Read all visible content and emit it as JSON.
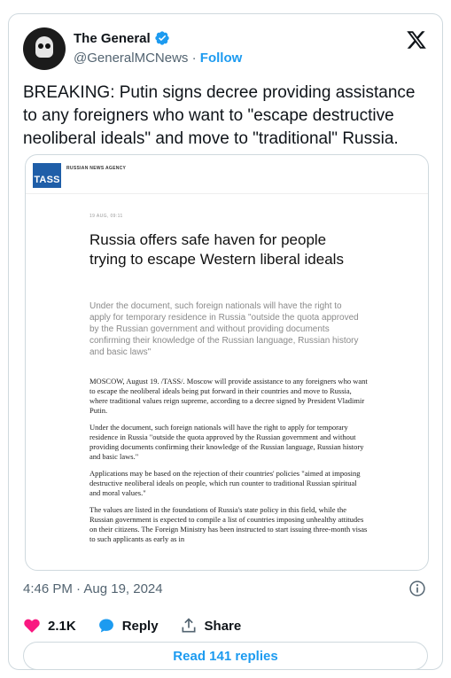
{
  "author": {
    "name": "The General",
    "handle": "@GeneralMCNews",
    "separator": "·",
    "follow_label": "Follow"
  },
  "tweet": {
    "text": "BREAKING: Putin signs decree providing assistance to any foreigners who want to \"escape destructive neoliberal ideals\" and move to \"traditional\" Russia."
  },
  "media": {
    "agency_logo": "TASS",
    "agency_name": "RUSSIAN NEWS AGENCY",
    "date": "19 AUG, 09:11",
    "title": "Russia offers safe haven for people trying to escape Western liberal ideals",
    "lead": "Under the document, such foreign nationals will have the right to apply for temporary residence in Russia \"outside the quota approved by the Russian government and without providing documents confirming their knowledge of the Russian language, Russian history and basic laws\"",
    "paragraphs": [
      "MOSCOW, August 19. /TASS/. Moscow will provide assistance to any foreigners who want to escape the neoliberal ideals being put forward in their countries and move to Russia, where traditional values reign supreme, according to a decree signed by President Vladimir Putin.",
      "Under the document, such foreign nationals will have the right to apply for temporary residence in Russia \"outside the quota approved by the Russian government and without providing documents confirming their knowledge of the Russian language, Russian history and basic laws.\"",
      "Applications may be based on the rejection of their countries' policies \"aimed at imposing destructive neoliberal ideals on people, which run counter to traditional Russian spiritual and moral values.\"",
      "The values are listed in the foundations of Russia's state policy in this field, while the Russian government is expected to compile a list of countries imposing unhealthy attitudes on their citizens. The Foreign Ministry has been instructed to start issuing three-month visas to such applicants as early as in"
    ]
  },
  "timestamp": "4:46 PM · Aug 19, 2024",
  "actions": {
    "like_count": "2.1K",
    "reply_label": "Reply",
    "share_label": "Share"
  },
  "read_replies_label": "Read 141 replies",
  "colors": {
    "accent": "#1d9bf0",
    "like": "#f91880",
    "muted": "#536471",
    "tass_blue": "#1f5ea8"
  },
  "icons": [
    "verified-badge-icon",
    "x-logo-icon",
    "info-icon",
    "heart-icon",
    "reply-bubble-icon",
    "share-icon"
  ]
}
